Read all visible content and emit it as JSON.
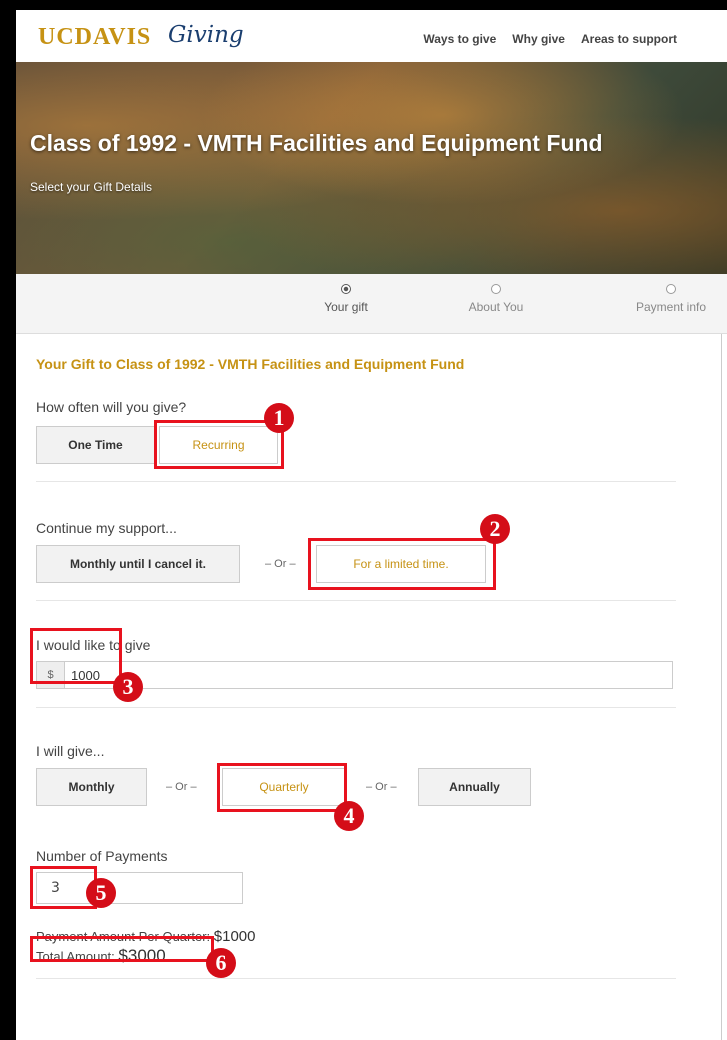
{
  "header": {
    "logo_uc": "UCDAVIS",
    "logo_giving": "Giving",
    "nav": [
      "Ways to give",
      "Why give",
      "Areas to support"
    ]
  },
  "hero": {
    "title": "Class of 1992 - VMTH Facilities and Equipment Fund",
    "subtitle": "Select your Gift Details"
  },
  "steps": [
    {
      "label": "Your gift",
      "active": true
    },
    {
      "label": "About You",
      "active": false
    },
    {
      "label": "Payment info",
      "active": false
    }
  ],
  "form": {
    "heading": "Your Gift to Class of 1992 - VMTH Facilities and Equipment Fund",
    "frequency": {
      "label": "How often will you give?",
      "one_time": "One Time",
      "recurring": "Recurring"
    },
    "continue": {
      "label": "Continue my support...",
      "monthly_until_cancel": "Monthly until I cancel it.",
      "or": "– Or –",
      "limited_time": "For a limited time."
    },
    "amount": {
      "label": "I would like to give",
      "prefix": "$",
      "value": "1000"
    },
    "interval": {
      "label": "I will give...",
      "monthly": "Monthly",
      "or": "– Or –",
      "quarterly": "Quarterly",
      "annually": "Annually"
    },
    "payments": {
      "label": "Number of Payments",
      "value": "3"
    },
    "summary": {
      "per_quarter_label": "Payment Amount Per Quarter:",
      "per_quarter_value": "$1000",
      "total_label": "Total Amount:",
      "total_value": "$3000"
    }
  },
  "annotations": [
    "1",
    "2",
    "3",
    "4",
    "5",
    "6"
  ],
  "colors": {
    "accent": "#c69214",
    "annotation": "#e8121e",
    "frame": "#000000"
  }
}
